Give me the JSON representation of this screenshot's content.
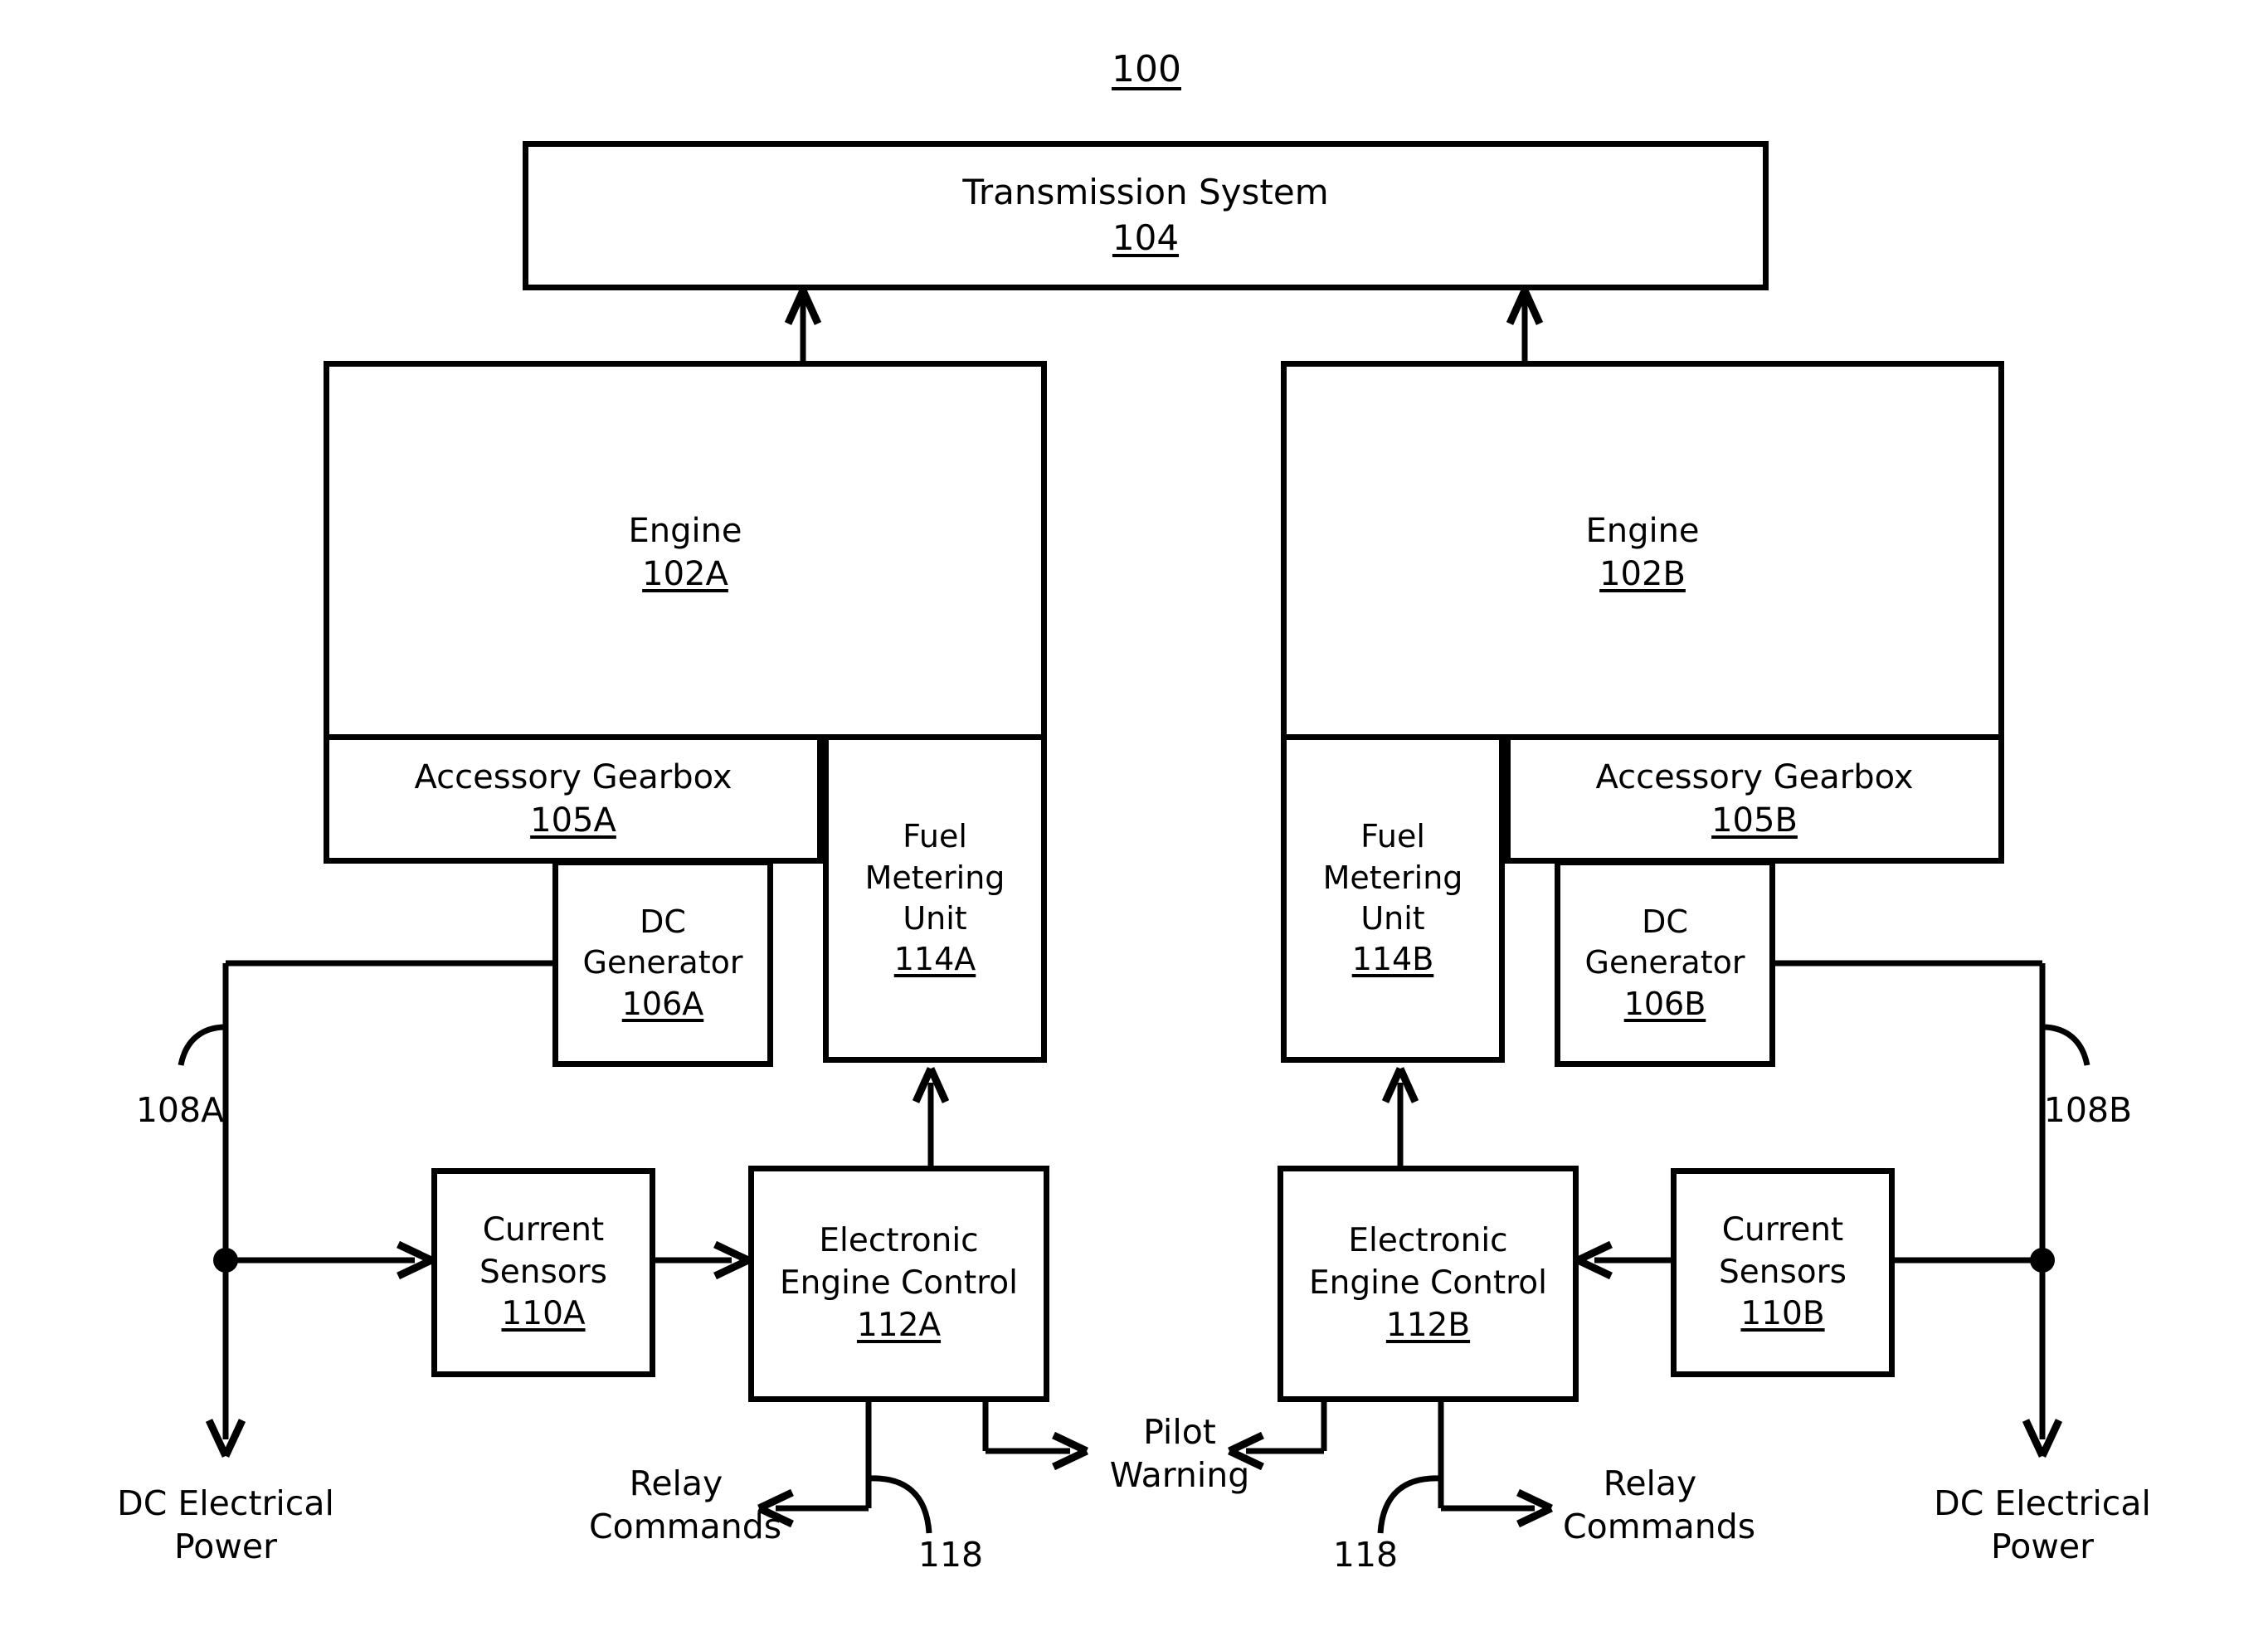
{
  "figure": {
    "number": "100"
  },
  "blocks": {
    "transmission": {
      "title": "Transmission System",
      "ref": "104"
    },
    "engine_a": {
      "title": "Engine",
      "ref": "102A"
    },
    "engine_b": {
      "title": "Engine",
      "ref": "102B"
    },
    "gearbox_a": {
      "title": "Accessory Gearbox",
      "ref": "105A"
    },
    "gearbox_b": {
      "title": "Accessory Gearbox",
      "ref": "105B"
    },
    "generator_a": {
      "title": "DC\nGenerator",
      "ref": "106A"
    },
    "generator_b": {
      "title": "DC\nGenerator",
      "ref": "106B"
    },
    "fmu_a": {
      "title": "Fuel\nMetering\nUnit",
      "ref": "114A"
    },
    "fmu_b": {
      "title": "Fuel\nMetering\nUnit",
      "ref": "114B"
    },
    "sensors_a": {
      "title": "Current\nSensors",
      "ref": "110A"
    },
    "sensors_b": {
      "title": "Current\nSensors",
      "ref": "110B"
    },
    "eec_a": {
      "title": "Electronic\nEngine Control",
      "ref": "112A"
    },
    "eec_b": {
      "title": "Electronic\nEngine Control",
      "ref": "112B"
    }
  },
  "labels": {
    "bus_a": "108A",
    "bus_b": "108B",
    "relay_bus_a": "118",
    "relay_bus_b": "118",
    "dc_power_a": "DC Electrical\nPower",
    "dc_power_b": "DC Electrical\nPower",
    "relay_commands_a": "Relay\nCommands",
    "relay_commands_b": "Relay\nCommands",
    "pilot_warning": "Pilot\nWarning"
  },
  "colors": {
    "line": "#000000",
    "background": "#ffffff",
    "text": "#000000"
  }
}
